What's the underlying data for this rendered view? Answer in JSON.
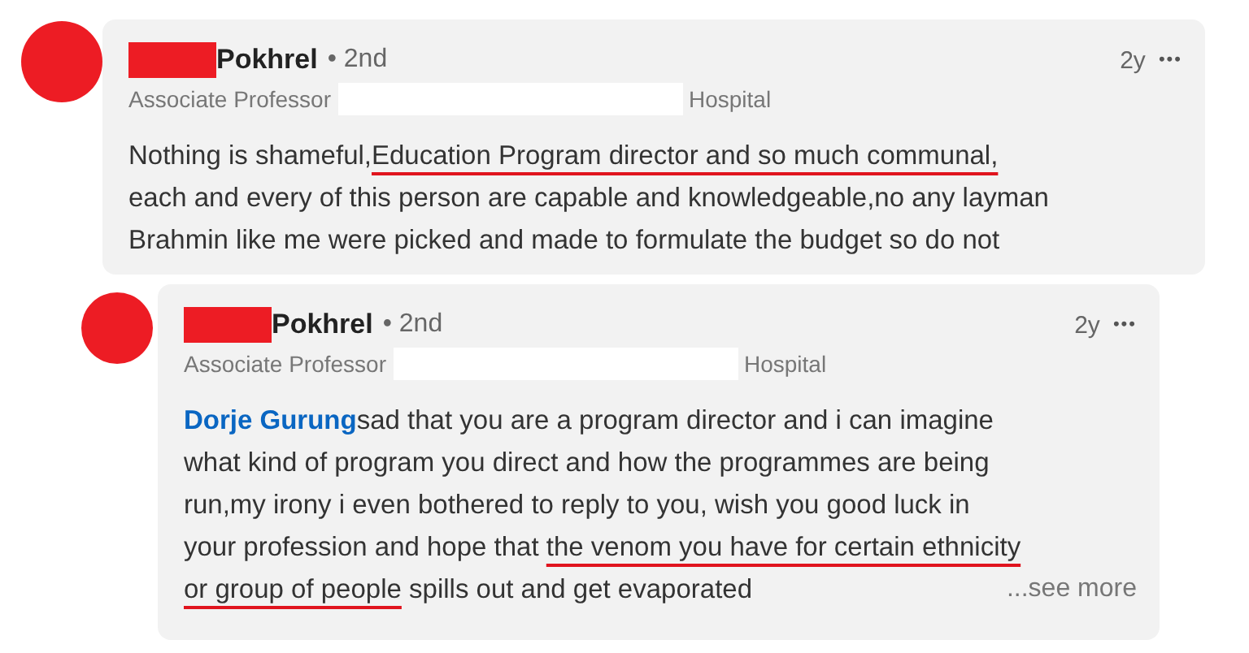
{
  "comments": [
    {
      "name": "Pokhrel",
      "degree": "• 2nd",
      "headline_start": "Associate Professor",
      "headline_end": "Hospital",
      "time": "2y",
      "more": "•••",
      "lines": [
        [
          {
            "text": "Nothing is shameful,",
            "underlined": false,
            "kind": "text"
          },
          {
            "text": "Education Program director and so much communal,",
            "underlined": true,
            "kind": "text"
          }
        ],
        [
          {
            "text": "each and every of this person are capable and knowledgeable,no any layman",
            "underlined": false,
            "kind": "text"
          }
        ],
        [
          {
            "text": "Brahmin like me were picked and made to formulate the budget so do not",
            "underlined": false,
            "kind": "text"
          }
        ]
      ]
    },
    {
      "name": "Pokhrel",
      "degree": "• 2nd",
      "headline_start": "Associate Professor",
      "headline_end": "Hospital",
      "time": "2y",
      "more": "•••",
      "see_more": "...see more",
      "lines": [
        [
          {
            "text": "Dorje Gurung",
            "underlined": false,
            "kind": "mention"
          },
          {
            "text": "sad that you are a program director and i can imagine",
            "underlined": false,
            "kind": "text"
          }
        ],
        [
          {
            "text": "what kind of program you direct and how the programmes are being",
            "underlined": false,
            "kind": "text"
          }
        ],
        [
          {
            "text": "run,my irony i even bothered to reply to you, wish you good luck in",
            "underlined": false,
            "kind": "text"
          }
        ],
        [
          {
            "text": "your profession and hope that ",
            "underlined": false,
            "kind": "text"
          },
          {
            "text": "the venom you have for certain ethnicity",
            "underlined": true,
            "kind": "text"
          }
        ],
        [
          {
            "text": "or group of people",
            "underlined": true,
            "kind": "text"
          },
          {
            "text": " spills out and get evaporated",
            "underlined": false,
            "kind": "text"
          }
        ]
      ]
    }
  ]
}
